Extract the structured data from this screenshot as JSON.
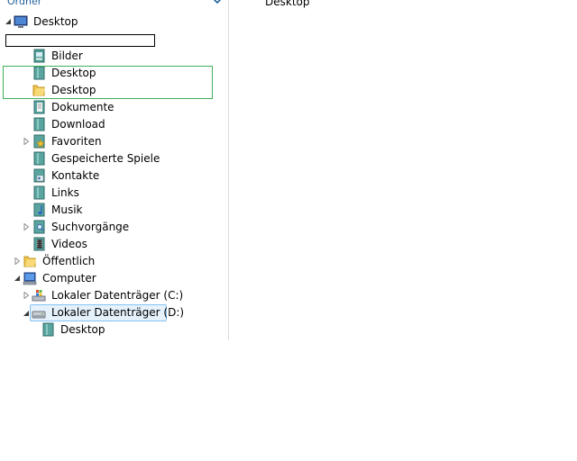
{
  "header": {
    "label": "Ordner",
    "chevron_icon": "chevron-down-icon"
  },
  "tree": [
    {
      "name": "desktop-root",
      "label": "Desktop",
      "icon": "monitor-icon",
      "expander": "expanded"
    },
    {
      "name": "bilder",
      "label": "Bilder",
      "icon": "pictures-icon",
      "expander": "none"
    },
    {
      "name": "desktop-1",
      "label": "Desktop",
      "icon": "user-folder-icon",
      "expander": "none"
    },
    {
      "name": "desktop-2",
      "label": "Desktop",
      "icon": "folder-icon",
      "expander": "none"
    },
    {
      "name": "dokumente",
      "label": "Dokumente",
      "icon": "documents-icon",
      "expander": "none"
    },
    {
      "name": "download",
      "label": "Download",
      "icon": "user-folder-icon",
      "expander": "none"
    },
    {
      "name": "favoriten",
      "label": "Favoriten",
      "icon": "favorites-star-icon",
      "expander": "collapsed"
    },
    {
      "name": "gespeicherte-spiele",
      "label": "Gespeicherte Spiele",
      "icon": "user-folder-icon",
      "expander": "none"
    },
    {
      "name": "kontakte",
      "label": "Kontakte",
      "icon": "contacts-icon",
      "expander": "none"
    },
    {
      "name": "links",
      "label": "Links",
      "icon": "user-folder-icon",
      "expander": "none"
    },
    {
      "name": "musik",
      "label": "Musik",
      "icon": "music-icon",
      "expander": "none"
    },
    {
      "name": "suchvorgaenge",
      "label": "Suchvorgänge",
      "icon": "searches-icon",
      "expander": "collapsed"
    },
    {
      "name": "videos",
      "label": "Videos",
      "icon": "videos-icon",
      "expander": "none"
    },
    {
      "name": "oeffentlich",
      "label": "Öffentlich",
      "icon": "folder-icon",
      "expander": "collapsed"
    },
    {
      "name": "computer",
      "label": "Computer",
      "icon": "computer-icon",
      "expander": "expanded"
    },
    {
      "name": "drive-c",
      "label": "Lokaler Datenträger (C:)",
      "icon": "windows-drive-icon",
      "expander": "collapsed"
    },
    {
      "name": "drive-d",
      "label": "Lokaler Datenträger (D:)",
      "icon": "drive-icon",
      "expander": "expanded",
      "selected": true
    },
    {
      "name": "desktop-d",
      "label": "Desktop",
      "icon": "user-folder-icon",
      "expander": "none"
    }
  ],
  "rename_field": {
    "value": ""
  },
  "content": {
    "item_label": "Desktop"
  },
  "colors": {
    "accent_blue": "#1e5f9a",
    "selection_bg": "#e5f1fb",
    "selection_border": "#84c1f4",
    "drop_target_border": "#3faf58"
  }
}
